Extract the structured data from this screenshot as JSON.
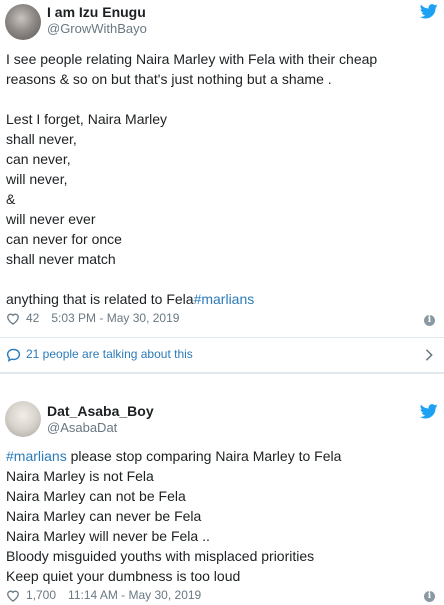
{
  "tweets": [
    {
      "display_name": "I am Izu Enugu",
      "handle": "@GrowWithBayo",
      "lines": [
        "I see people relating Naira Marley with Fela with their cheap",
        "reasons & so on but that's just nothing but a shame .",
        "",
        "Lest I forget, Naira Marley",
        "shall never,",
        "can never,",
        "will never,",
        "&",
        "will never ever",
        "can never for once",
        "shall never match",
        "",
        "anything that is related to Fela"
      ],
      "hashtag": "#marlians",
      "likes": "42",
      "timestamp": "5:03 PM - May 30, 2019",
      "talking": "21 people are talking about this"
    },
    {
      "display_name": "Dat_Asaba_Boy",
      "handle": "@AsabaDat",
      "hashtag": "#marlians",
      "first_line_rest": " please stop comparing Naira Marley to Fela",
      "lines": [
        "Naira Marley is not Fela",
        "Naira Marley can not be Fela",
        "Naira Marley can never be Fela",
        "Naira Marley will never be Fela ..",
        "Bloody misguided youths with misplaced priorities",
        "Keep quiet your dumbness is too loud"
      ],
      "likes": "1,700",
      "timestamp": "11:14 AM - May 30, 2019"
    }
  ],
  "icons": {
    "brand": "twitter-bird-icon",
    "like": "heart-icon",
    "info": "info-icon",
    "reply": "speech-bubble-icon",
    "more": "chevron-right-icon"
  },
  "colors": {
    "link": "#2b7bb9",
    "brand": "#1da1f2",
    "muted": "#697882",
    "text": "#1c2022",
    "divider": "#e1e8ed"
  }
}
